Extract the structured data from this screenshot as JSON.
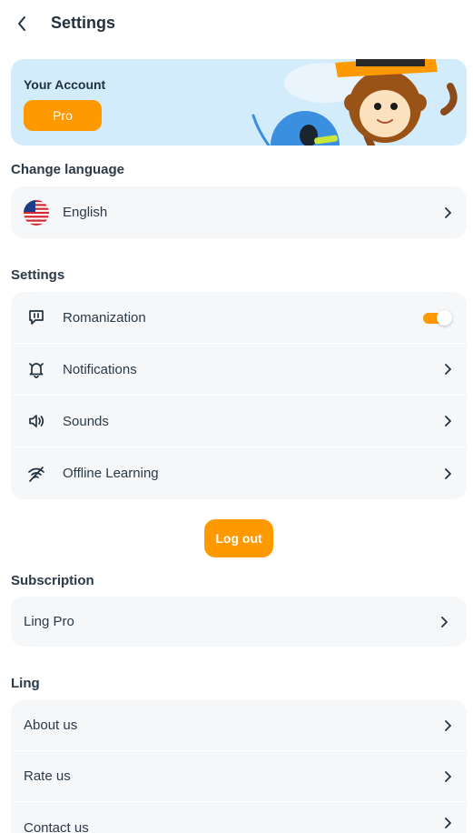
{
  "header": {
    "title": "Settings"
  },
  "account": {
    "title": "Your Account",
    "pro_label": "Pro"
  },
  "language": {
    "section_title": "Change language",
    "current": "English"
  },
  "settings": {
    "section_title": "Settings",
    "items": [
      {
        "label": "Romanization",
        "icon": "romanization-icon",
        "toggle_on": true
      },
      {
        "label": "Notifications",
        "icon": "bell-icon"
      },
      {
        "label": "Sounds",
        "icon": "speaker-icon"
      },
      {
        "label": "Offline Learning",
        "icon": "wifi-off-icon"
      }
    ]
  },
  "logout": {
    "label": "Log out"
  },
  "subscription": {
    "section_title": "Subscription",
    "items": [
      {
        "label": "Ling Pro"
      }
    ]
  },
  "ling": {
    "section_title": "Ling",
    "items": [
      {
        "label": "About us"
      },
      {
        "label": "Rate us"
      },
      {
        "label": "Contact us"
      }
    ]
  },
  "colors": {
    "accent": "#ff9900",
    "card_bg": "#f5f7f9",
    "banner_bg": "#d3ecfb",
    "text": "#22313f"
  }
}
